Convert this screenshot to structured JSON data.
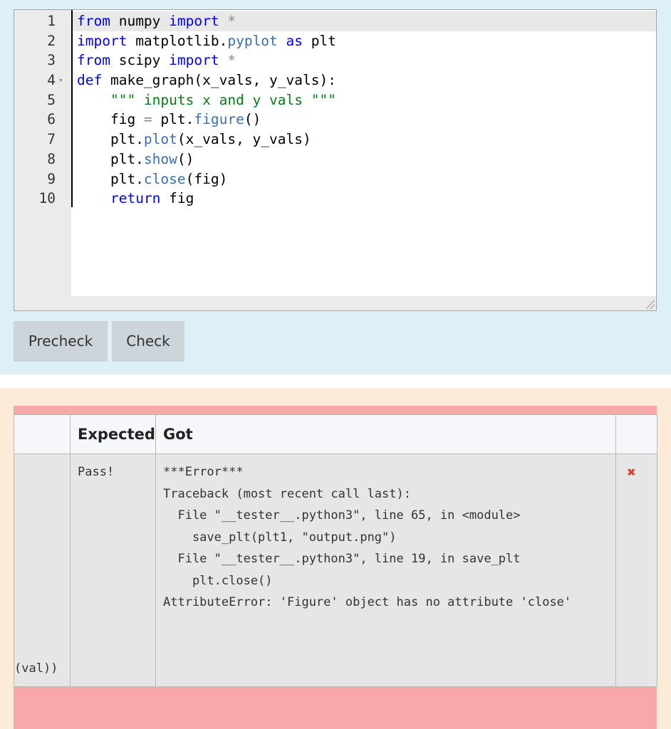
{
  "editor": {
    "lines": [
      {
        "num": "1",
        "tokens": [
          {
            "t": "from",
            "c": "kw"
          },
          {
            "t": " numpy ",
            "c": ""
          },
          {
            "t": "import",
            "c": "kw"
          },
          {
            "t": " *",
            "c": "op"
          }
        ]
      },
      {
        "num": "2",
        "tokens": [
          {
            "t": "import",
            "c": "kw"
          },
          {
            "t": " matplotlib.",
            "c": ""
          },
          {
            "t": "pyplot",
            "c": "fn"
          },
          {
            "t": " ",
            "c": ""
          },
          {
            "t": "as",
            "c": "kw"
          },
          {
            "t": " plt",
            "c": ""
          }
        ]
      },
      {
        "num": "3",
        "tokens": [
          {
            "t": "from",
            "c": "kw"
          },
          {
            "t": " scipy ",
            "c": ""
          },
          {
            "t": "import",
            "c": "kw"
          },
          {
            "t": " *",
            "c": "op"
          }
        ]
      },
      {
        "num": "4",
        "fold": true,
        "tokens": [
          {
            "t": "def",
            "c": "kw"
          },
          {
            "t": " make_graph(x_vals, y_vals):",
            "c": ""
          }
        ]
      },
      {
        "num": "5",
        "tokens": [
          {
            "t": "    ",
            "c": ""
          },
          {
            "t": "\"\"\" inputs x and y vals \"\"\"",
            "c": "str"
          }
        ]
      },
      {
        "num": "6",
        "tokens": [
          {
            "t": "    fig ",
            "c": ""
          },
          {
            "t": "=",
            "c": "op"
          },
          {
            "t": " plt.",
            "c": ""
          },
          {
            "t": "figure",
            "c": "fn"
          },
          {
            "t": "()",
            "c": ""
          }
        ]
      },
      {
        "num": "7",
        "tokens": [
          {
            "t": "    plt.",
            "c": ""
          },
          {
            "t": "plot",
            "c": "fn"
          },
          {
            "t": "(x_vals, y_vals)",
            "c": ""
          }
        ]
      },
      {
        "num": "8",
        "tokens": [
          {
            "t": "    plt.",
            "c": ""
          },
          {
            "t": "show",
            "c": "fn"
          },
          {
            "t": "()",
            "c": ""
          }
        ]
      },
      {
        "num": "9",
        "tokens": [
          {
            "t": "    plt.",
            "c": ""
          },
          {
            "t": "close",
            "c": "fn"
          },
          {
            "t": "(fig)",
            "c": ""
          }
        ]
      },
      {
        "num": "10",
        "tokens": [
          {
            "t": "    ",
            "c": ""
          },
          {
            "t": "return",
            "c": "kw"
          },
          {
            "t": " fig",
            "c": ""
          }
        ]
      }
    ],
    "fold_icon": "▾"
  },
  "buttons": {
    "precheck_label": "Precheck",
    "check_label": "Check"
  },
  "results": {
    "headers": {
      "test": "",
      "expected": "Expected",
      "got": "Got",
      "status": ""
    },
    "row": {
      "test_fragment": "(val))",
      "expected": "Pass!",
      "got_lines": [
        "***Error***",
        "Traceback (most recent call last):",
        "  File \"__tester__.python3\", line 65, in <module>",
        "    save_plt(plt1, \"output.png\")",
        "  File \"__tester__.python3\", line 19, in save_plt",
        "    plt.close()",
        "AttributeError: 'Figure' object has no attribute 'close'"
      ],
      "status_icon": "✖",
      "status_icon_name": "cross-icon"
    }
  },
  "colors": {
    "editor_panel_bg": "#def0f7",
    "result_panel_bg": "#fcebd6",
    "fail_bar": "#f9a7a8",
    "status_fail": "#d9432f"
  }
}
